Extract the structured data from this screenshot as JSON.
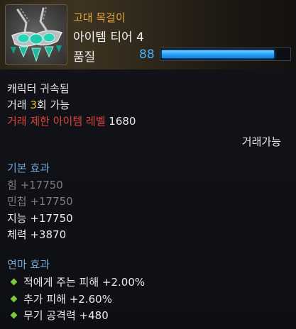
{
  "item": {
    "grade": "고대 목걸이",
    "tier": "아이템 티어 4",
    "quality_label": "품질",
    "quality_value": "88",
    "quality_fraction": 0.88
  },
  "info": {
    "bound": "캐릭터 귀속됨",
    "trade_prefix": "거래 ",
    "trade_count": "3",
    "trade_suffix": "회 가능",
    "restriction_label": "거래 제한 아이템 레벨",
    "restriction_level": "1680",
    "tradable": "거래가능"
  },
  "basic": {
    "header": "기본 효과",
    "stats": [
      {
        "label": "힘 +17750"
      },
      {
        "label": "민첩 +17750"
      },
      {
        "label": "지능 +17750"
      },
      {
        "label": "체력 +3870"
      }
    ]
  },
  "refine": {
    "header": "연마 효과",
    "effects": [
      {
        "label": "적에게 주는 피해 +2.00%"
      },
      {
        "label": "추가 피해 +2.60%"
      },
      {
        "label": "무기 공격력 +480"
      }
    ]
  },
  "colors": {
    "grade": "#e5a940",
    "quality": "#49b3ff",
    "restriction": "#d9453a",
    "trade_count": "#f2c033",
    "section_header": "#6fa6d8",
    "bullet": "#7cc83e"
  },
  "icons": {
    "item_icon": "necklace-icon",
    "bullet": "green-diamond-bullet"
  }
}
